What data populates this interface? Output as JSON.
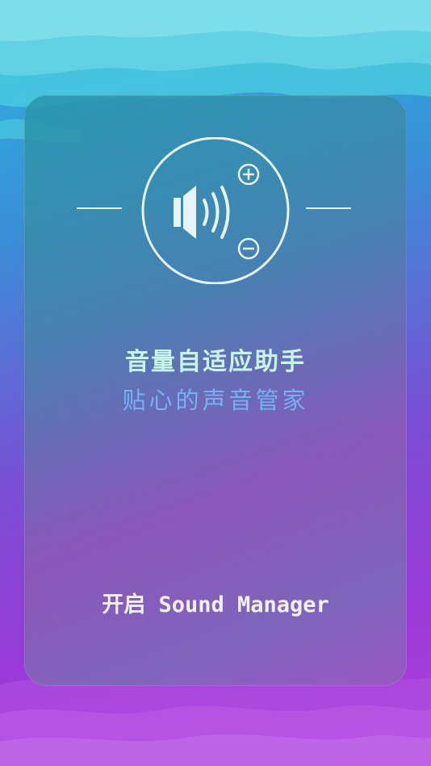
{
  "app": {
    "title": "音量自适应助手",
    "subtitle": "贴心的声音管家",
    "start_button_label": "开启 Sound Manager"
  },
  "icons": {
    "speaker": "speaker-volume-icon",
    "plus": "plus-icon",
    "minus": "minus-icon"
  },
  "colors": {
    "title": "#c8f4ec",
    "subtitle": "#78b0f4",
    "button_text": "#f4f0fa"
  }
}
